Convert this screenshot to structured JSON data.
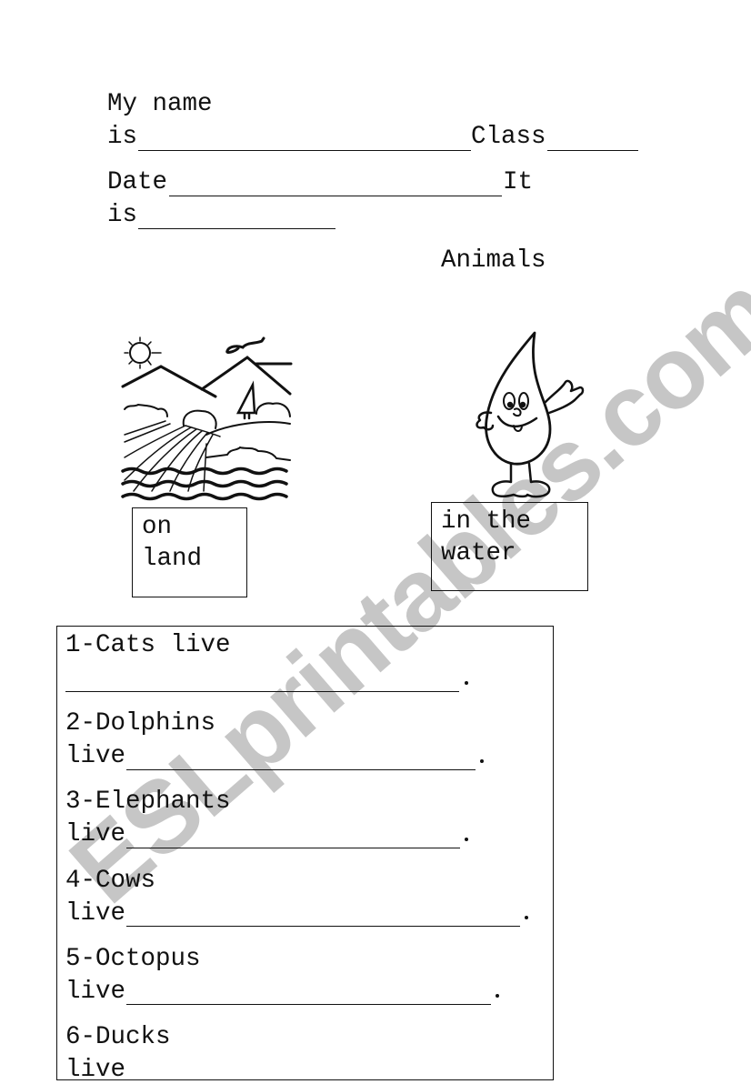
{
  "header": {
    "name_label_1": "My name",
    "name_label_2": "is",
    "class_label": "Class",
    "date_label": "Date",
    "it_label": "It",
    "is_label": "is"
  },
  "title": "Animals",
  "images": {
    "land": "landscape-illustration",
    "water": "water-drop-character"
  },
  "labels": {
    "land": [
      "on",
      "land"
    ],
    "water": [
      "in the",
      "water"
    ]
  },
  "exercises": [
    {
      "line1": "1-Cats live",
      "line2": ""
    },
    {
      "line1": "2-Dolphins",
      "line2": "live"
    },
    {
      "line1": "3-Elephants",
      "line2": "live"
    },
    {
      "line1": "4-Cows",
      "line2": "live"
    },
    {
      "line1": "5-Octopus",
      "line2": "live"
    },
    {
      "line1": "6-Ducks",
      "line2": "live"
    }
  ],
  "watermark": "ESLprintables.com",
  "colors": {
    "ink": "#111111",
    "watermark": "#c6c6c6",
    "paper": "#ffffff"
  }
}
